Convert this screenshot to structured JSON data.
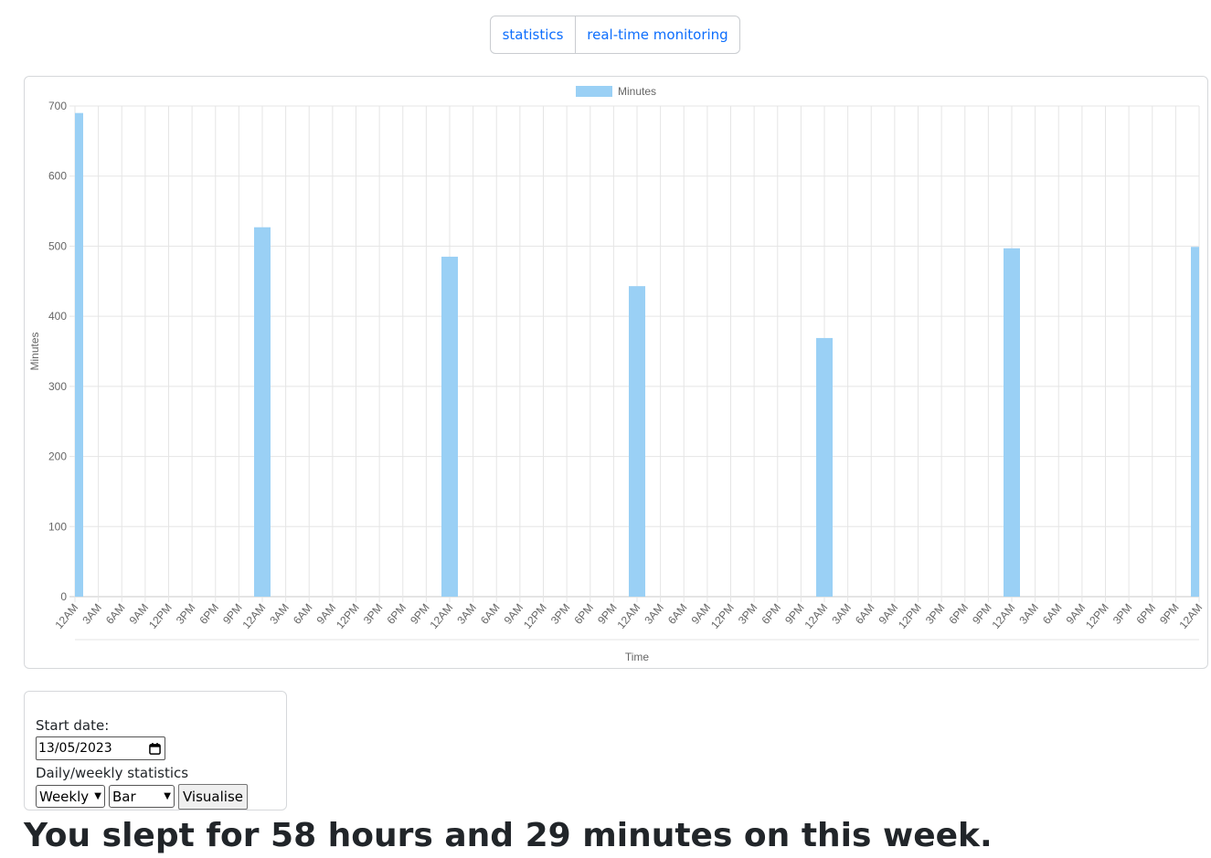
{
  "nav": {
    "statistics_label": "statistics",
    "realtime_label": "real-time monitoring"
  },
  "chart_data": {
    "type": "bar",
    "legend": "Minutes",
    "legend_position": "top",
    "xlabel": "Time",
    "ylabel": "Minutes",
    "ylim": [
      0,
      700
    ],
    "y_ticks": [
      0,
      100,
      200,
      300,
      400,
      500,
      600,
      700
    ],
    "grid": true,
    "bar_color": "#9ad0f5",
    "categories": [
      "12AM",
      "3AM",
      "6AM",
      "9AM",
      "12PM",
      "3PM",
      "6PM",
      "9PM",
      "12AM",
      "3AM",
      "6AM",
      "9AM",
      "12PM",
      "3PM",
      "6PM",
      "9PM",
      "12AM",
      "3AM",
      "6AM",
      "9AM",
      "12PM",
      "3PM",
      "6PM",
      "9PM",
      "12AM",
      "3AM",
      "6AM",
      "9AM",
      "12PM",
      "3PM",
      "6PM",
      "9PM",
      "12AM",
      "3AM",
      "6AM",
      "9AM",
      "12PM",
      "3PM",
      "6PM",
      "9PM",
      "12AM",
      "3AM",
      "6AM",
      "9AM",
      "12PM",
      "3PM",
      "6PM",
      "9PM",
      "12AM"
    ],
    "values": [
      690,
      0,
      0,
      0,
      0,
      0,
      0,
      0,
      527,
      0,
      0,
      0,
      0,
      0,
      0,
      0,
      485,
      0,
      0,
      0,
      0,
      0,
      0,
      0,
      443,
      0,
      0,
      0,
      0,
      0,
      0,
      0,
      369,
      0,
      0,
      0,
      0,
      0,
      0,
      0,
      497,
      0,
      0,
      0,
      0,
      0,
      0,
      0,
      499
    ]
  },
  "form": {
    "start_date_label": "Start date:",
    "start_date_value": "13/05/2023",
    "stats_label": "Daily/weekly statistics",
    "period_value": "Weekly",
    "chart_type_value": "Bar",
    "visualise_label": "Visualise"
  },
  "summary_text": "You slept for 58 hours and 29 minutes on this week."
}
